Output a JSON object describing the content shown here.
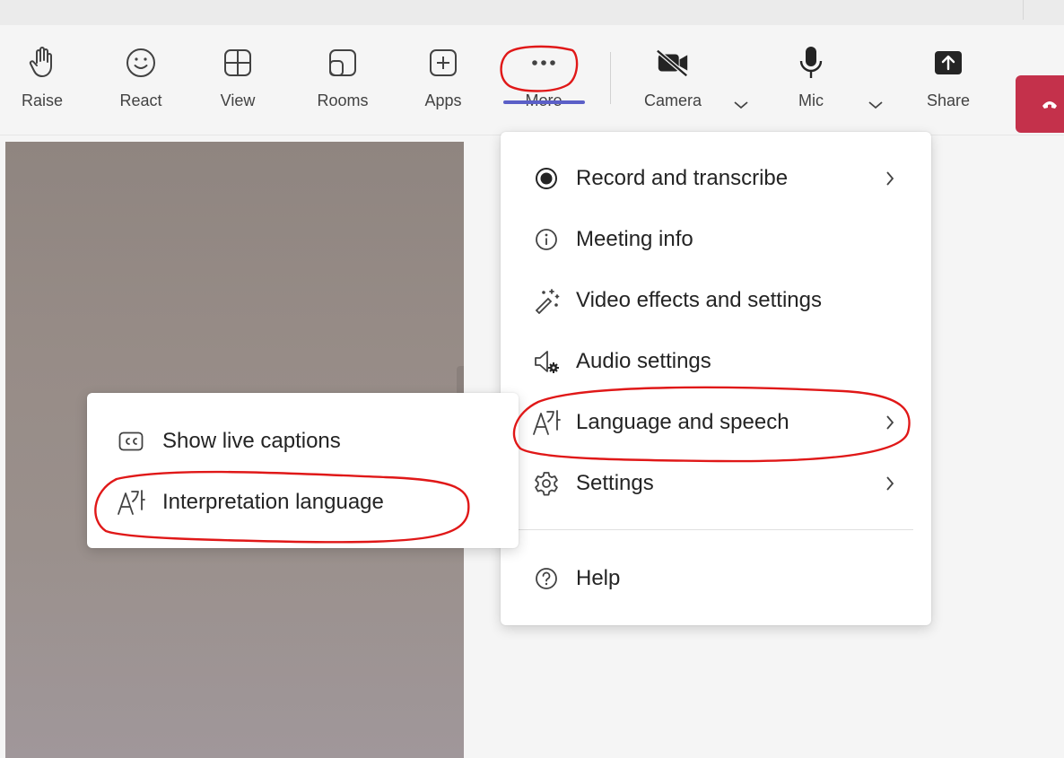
{
  "toolbar": {
    "buttons": [
      {
        "label": "Raise",
        "icon": "raise-hand-icon"
      },
      {
        "label": "React",
        "icon": "smiley-icon"
      },
      {
        "label": "View",
        "icon": "grid-view-icon"
      },
      {
        "label": "Rooms",
        "icon": "rooms-icon"
      },
      {
        "label": "Apps",
        "icon": "add-app-icon"
      },
      {
        "label": "More",
        "icon": "more-dots-icon"
      },
      {
        "label": "Camera",
        "icon": "camera-off-icon"
      },
      {
        "label": "Mic",
        "icon": "mic-icon"
      },
      {
        "label": "Share",
        "icon": "share-icon"
      }
    ],
    "active_button": "More",
    "hangup_color": "#c4314b",
    "accent_color": "#5b5fc7"
  },
  "more_menu": {
    "items": [
      {
        "label": "Record and transcribe",
        "icon": "record-icon",
        "has_submenu": true
      },
      {
        "label": "Meeting info",
        "icon": "info-icon",
        "has_submenu": false
      },
      {
        "label": "Video effects and settings",
        "icon": "magic-wand-icon",
        "has_submenu": false
      },
      {
        "label": "Audio settings",
        "icon": "speaker-settings-icon",
        "has_submenu": false
      },
      {
        "label": "Language and speech",
        "icon": "language-icon",
        "has_submenu": true
      },
      {
        "label": "Settings",
        "icon": "gear-icon",
        "has_submenu": true
      },
      {
        "label": "Help",
        "icon": "help-icon",
        "has_submenu": false
      }
    ]
  },
  "language_submenu": {
    "items": [
      {
        "label": "Show live captions",
        "icon": "captions-icon"
      },
      {
        "label": "Interpretation language",
        "icon": "language-icon"
      }
    ]
  },
  "annotation_color": "#e01818"
}
